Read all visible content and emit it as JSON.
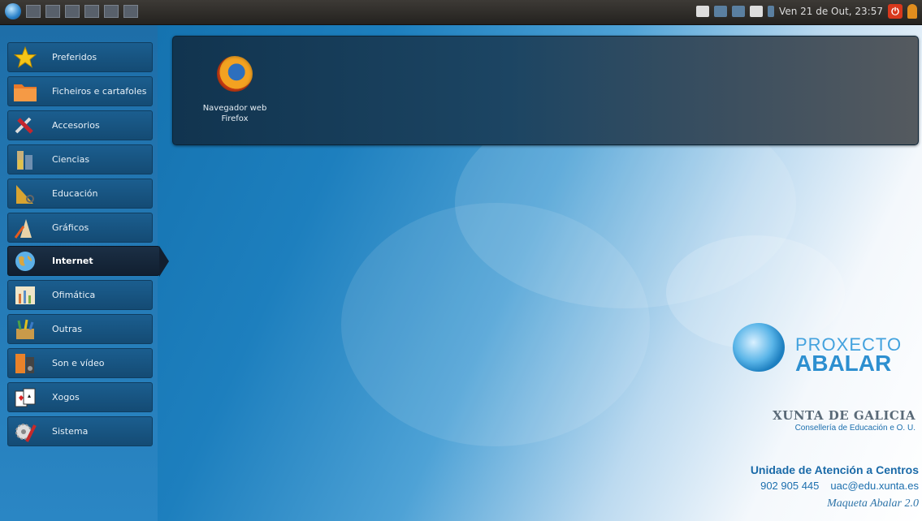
{
  "top_panel": {
    "taskbar_buttons": 6,
    "datetime": "Ven 21 de Out, 23:57"
  },
  "sidebar": {
    "items": [
      {
        "label": "Preferidos",
        "icon": "star-icon"
      },
      {
        "label": "Ficheiros e cartafoles",
        "icon": "folder-icon"
      },
      {
        "label": "Accesorios",
        "icon": "tools-icon"
      },
      {
        "label": "Ciencias",
        "icon": "science-icon"
      },
      {
        "label": "Educación",
        "icon": "education-icon"
      },
      {
        "label": "Gráficos",
        "icon": "graphics-icon"
      },
      {
        "label": "Internet",
        "icon": "globe-icon",
        "active": true
      },
      {
        "label": "Ofimática",
        "icon": "office-icon"
      },
      {
        "label": "Outras",
        "icon": "other-icon"
      },
      {
        "label": "Son e vídeo",
        "icon": "media-icon"
      },
      {
        "label": "Xogos",
        "icon": "games-icon"
      },
      {
        "label": "Sistema",
        "icon": "system-icon"
      }
    ]
  },
  "launcher": {
    "apps": [
      {
        "name_line1": "Navegador web",
        "name_line2": "Firefox",
        "icon": "firefox-icon"
      }
    ]
  },
  "branding": {
    "proxecto": "PROXECTO",
    "abalar": "ABALAR",
    "xunta": "XUNTA DE GALICIA",
    "conselleria": "Consellería de Educación e O. U.",
    "uac_title": "Unidade de Atención a Centros",
    "phone": "902 905 445",
    "email": "uac@edu.xunta.es",
    "maqueta": "Maqueta Abalar 2.0"
  },
  "colors": {
    "accent": "#1a6aa8",
    "sidebar_item": "#1b5e8f",
    "sidebar_active": "#121f30",
    "power": "#d8381c"
  }
}
